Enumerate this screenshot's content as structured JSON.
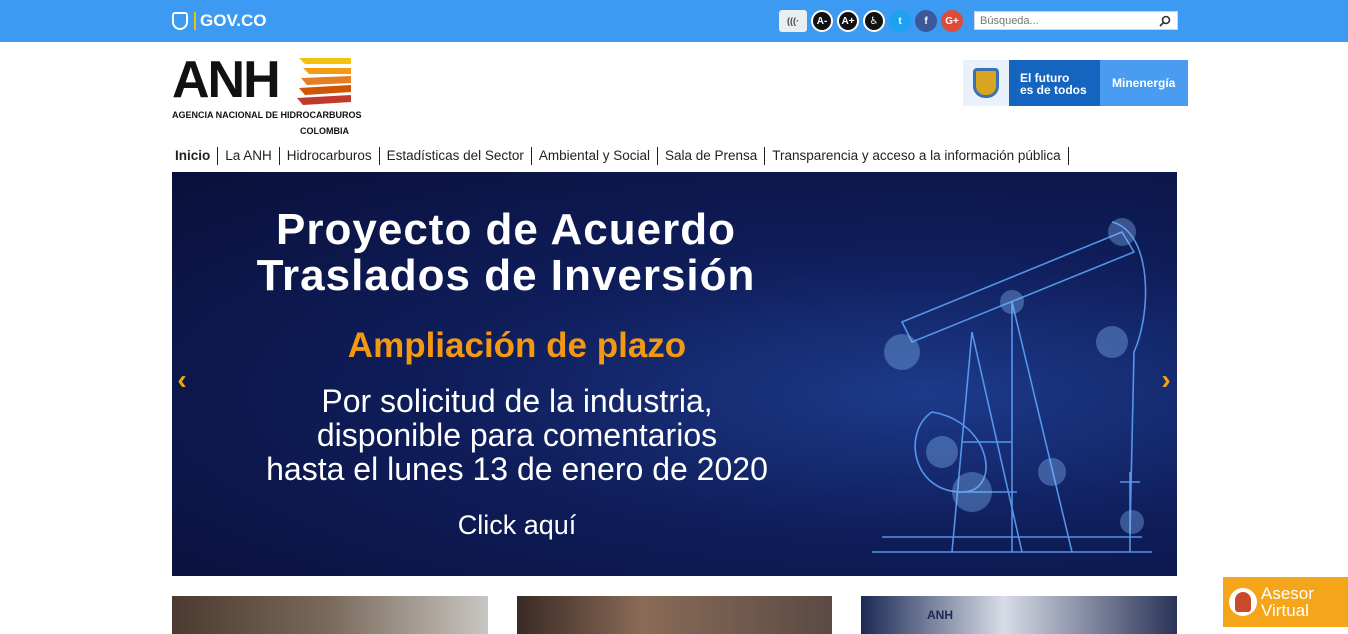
{
  "govbar": {
    "logo_text": "GOV.CO",
    "tools": [
      {
        "name": "audio",
        "label": "(((·"
      },
      {
        "name": "font-decrease",
        "label": "A-"
      },
      {
        "name": "font-increase",
        "label": "A+"
      },
      {
        "name": "accessibility",
        "label": "♿"
      },
      {
        "name": "twitter",
        "label": "t"
      },
      {
        "name": "facebook",
        "label": "f"
      },
      {
        "name": "google-plus",
        "label": "G+"
      }
    ],
    "search_placeholder": "Búsqueda..."
  },
  "header": {
    "logo_letters": "ANH",
    "logo_agency": "AGENCIA NACIONAL DE HIDROCARBUROS",
    "logo_country": "COLOMBIA",
    "gov_slogan_line1": "El futuro",
    "gov_slogan_line2": "es de todos",
    "ministry": "Minenergía"
  },
  "nav": {
    "items": [
      "Inicio",
      "La ANH",
      "Hidrocarburos",
      "Estadísticas del Sector",
      "Ambiental y Social",
      "Sala de Prensa",
      "Transparencia y acceso a la información pública"
    ]
  },
  "banner": {
    "title_line1": "Proyecto de Acuerdo",
    "title_line2": "Traslados de Inversión",
    "subtitle": "Ampliación de plazo",
    "body_line1": "Por solicitud de la industria,",
    "body_line2": "disponible para comentarios",
    "body_line3": "hasta el lunes 13 de enero de 2020",
    "cta": "Click aquí",
    "prev_arrow": "‹",
    "next_arrow": "›"
  },
  "news": {
    "thumb3_text": "ANH"
  },
  "asesor": {
    "line1": "Asesor",
    "line2": "Virtual"
  },
  "colors": {
    "govbar": "#3d9af2",
    "accent_orange": "#f29811",
    "banner_navy": "#0f1d5a"
  }
}
